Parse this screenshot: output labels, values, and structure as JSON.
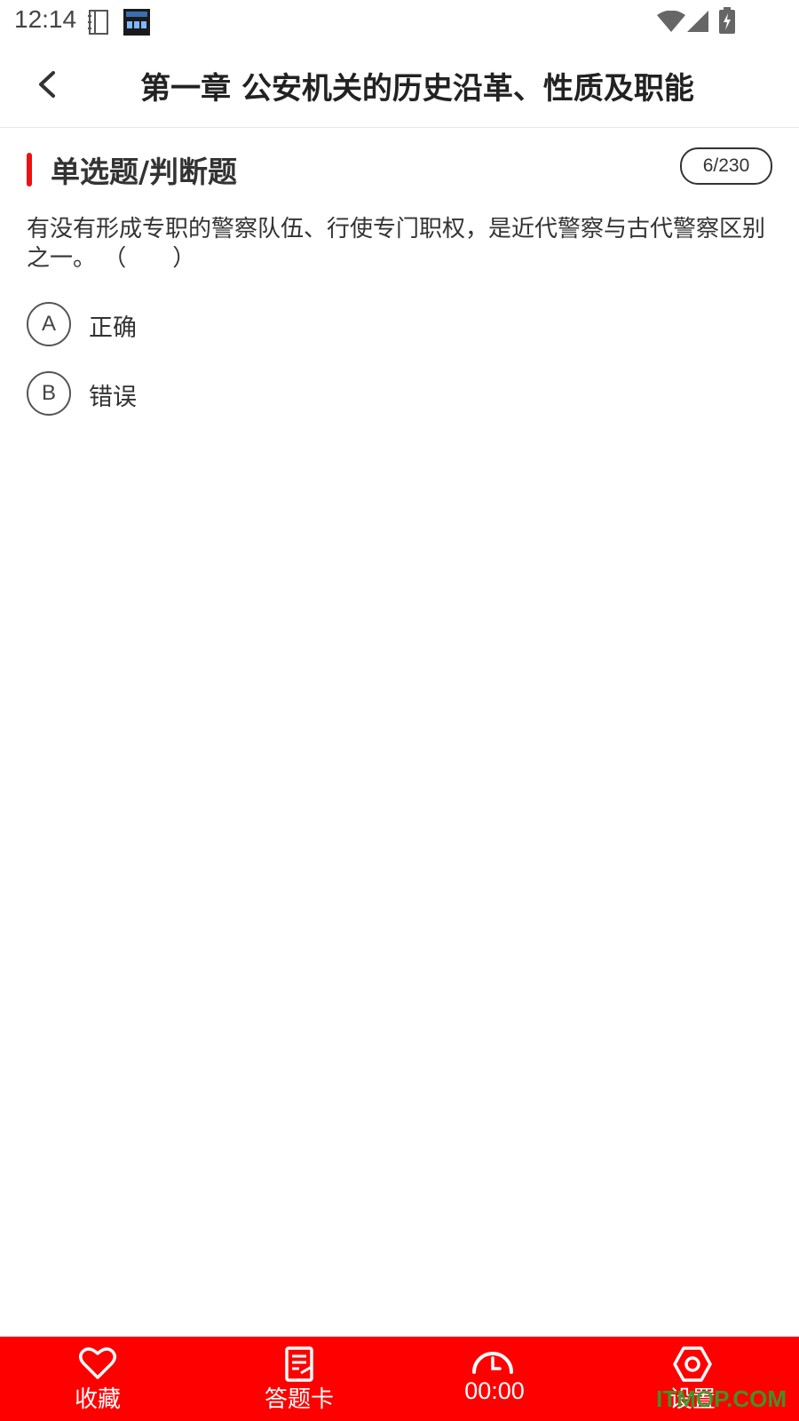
{
  "status_bar": {
    "time": "12:14"
  },
  "header": {
    "title": "第一章 公安机关的历史沿革、性质及职能"
  },
  "section": {
    "title": "单选题/判断题",
    "counter": "6/230"
  },
  "question": {
    "text": "有没有形成专职的警察队伍、行使专门职权，是近代警察与古代警察区别之一。 （　　）"
  },
  "options": [
    {
      "letter": "A",
      "text": "正确"
    },
    {
      "letter": "B",
      "text": "错误"
    }
  ],
  "bottom_nav": {
    "favorite": "收藏",
    "answer_card": "答题卡",
    "timer": "00:00",
    "settings": "设置"
  },
  "watermark": "ITMOP.COM",
  "colors": {
    "accent": "#ff0000",
    "section_bar": "#ee1111"
  }
}
